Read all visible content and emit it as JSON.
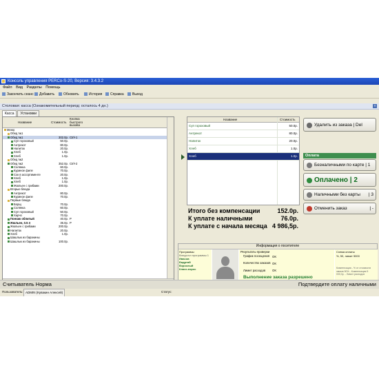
{
  "window": {
    "title": "Консоль управления PERCo-S-20, Версия: 3.4.3.2"
  },
  "menu": [
    "Файл",
    "Вид",
    "Разделы",
    "Помощь"
  ],
  "toolbar": [
    "Закончить сеанс",
    "Добавить",
    "Обновить",
    "История",
    "Справка",
    "Выход"
  ],
  "section_bar": "Столовая: касса (Ознакомительный период: осталось 4 дн.)",
  "tabs": [
    "Касса",
    "Установки"
  ],
  "menu_tree": {
    "columns": {
      "name": "Название",
      "cost": "Стоимость",
      "hotkey": "Кнопка быстрого вызова"
    },
    "rows": [
      {
        "n": "Меню",
        "p": "",
        "k": "",
        "l": 0,
        "t": "f"
      },
      {
        "n": "Обед №1",
        "p": "",
        "k": "",
        "l": 1,
        "t": "f"
      },
      {
        "n": "Обед №1",
        "p": "302.0р.",
        "k": "Ctrl+1",
        "l": 1,
        "t": "d",
        "sel": true
      },
      {
        "n": "Суп гороховый",
        "p": "50.0р.",
        "k": "",
        "l": 2,
        "t": "d"
      },
      {
        "n": "Антрекот",
        "p": "80.0р.",
        "k": "",
        "l": 2,
        "t": "d"
      },
      {
        "n": "Напиток",
        "p": "20.0р.",
        "k": "",
        "l": 2,
        "t": "d"
      },
      {
        "n": "Хлеб",
        "p": "1.0р.",
        "k": "",
        "l": 2,
        "t": "d"
      },
      {
        "n": "Хлеб",
        "p": "1.0р.",
        "k": "",
        "l": 2,
        "t": "d"
      },
      {
        "n": "Обед №2",
        "p": "",
        "k": "",
        "l": 1,
        "t": "f"
      },
      {
        "n": "Обед №2",
        "p": "352.0р.",
        "k": "Ctrl+2",
        "l": 1,
        "t": "d"
      },
      {
        "n": "Солянка",
        "p": "60.0р.",
        "k": "",
        "l": 2,
        "t": "d"
      },
      {
        "n": "Куриное филе",
        "p": "70.0р.",
        "k": "",
        "l": 2,
        "t": "d"
      },
      {
        "n": "Сок в ассортименте",
        "p": "20.0р.",
        "k": "",
        "l": 2,
        "t": "d"
      },
      {
        "n": "Хлеб",
        "p": "1.0р.",
        "k": "",
        "l": 2,
        "t": "d"
      },
      {
        "n": "Хлеб",
        "p": "1.0р.",
        "k": "",
        "l": 2,
        "t": "d"
      },
      {
        "n": "Жюльен с грибами",
        "p": "200.0р.",
        "k": "",
        "l": 2,
        "t": "d"
      },
      {
        "n": "Вторые блюда",
        "p": "",
        "k": "",
        "l": 1,
        "t": "f"
      },
      {
        "n": "Антрекот",
        "p": "80.0р.",
        "k": "",
        "l": 2,
        "t": "d"
      },
      {
        "n": "Куриное филе",
        "p": "70.0р.",
        "k": "",
        "l": 2,
        "t": "d"
      },
      {
        "n": "Первые блюда",
        "p": "",
        "k": "",
        "l": 1,
        "t": "f"
      },
      {
        "n": "Борщ",
        "p": "70.0р.",
        "k": "",
        "l": 2,
        "t": "d"
      },
      {
        "n": "Солянка",
        "p": "60.0р.",
        "k": "",
        "l": 2,
        "t": "d"
      },
      {
        "n": "Суп гороховый",
        "p": "50.0р.",
        "k": "",
        "l": 2,
        "t": "d"
      },
      {
        "n": "Харчо",
        "p": "70.0р.",
        "k": "",
        "l": 2,
        "t": "d"
      },
      {
        "n": "Пончик облитый",
        "p": "40.0р.",
        "k": "P",
        "l": 1,
        "t": "d",
        "b": true
      },
      {
        "n": "Жюльен, 0.5 л",
        "p": "35.0р.",
        "k": "Р",
        "l": 1,
        "t": "d",
        "b": true
      },
      {
        "n": "Жюльен с грибами",
        "p": "200.0р.",
        "k": "",
        "l": 1,
        "t": "d"
      },
      {
        "n": "Напиток",
        "p": "20.0р.",
        "k": "",
        "l": 1,
        "t": "d"
      },
      {
        "n": "Хлеб",
        "p": "1.0р.",
        "k": "",
        "l": 1,
        "t": "d"
      },
      {
        "n": "Шашлык из баранины",
        "p": "",
        "k": "",
        "l": 1,
        "t": "d"
      },
      {
        "n": "Шашлык из баранины",
        "p": "100.0р.",
        "k": "",
        "l": 1,
        "t": "d"
      }
    ]
  },
  "order": {
    "columns": {
      "name": "Название",
      "cost": "Стоимость"
    },
    "rows": [
      {
        "n": "Суп гороховый",
        "p": "50.0р."
      },
      {
        "n": "Антрекот",
        "p": "80.0р."
      },
      {
        "n": "Напиток",
        "p": "20.0р."
      },
      {
        "n": "Хлеб",
        "p": "1.0р."
      },
      {
        "n": "Хлеб",
        "p": "1.0р.",
        "sel": true
      }
    ]
  },
  "totals": [
    {
      "label": "Итого без компенсации",
      "value": "152.0р."
    },
    {
      "label": "К уплате наличными",
      "value": "76.0р."
    },
    {
      "label": "К уплате с начала месяца",
      "value": "4 986,5р."
    }
  ],
  "buttons": {
    "delete": "Удалить из заказа | Del",
    "pay_section": "Оплата",
    "cashless_card": "Безналичными по карте | 1",
    "paid": "Оплачено | 2",
    "cash_no_card": "Наличными без карты",
    "cash_no_card_key": "| 3",
    "cancel": "Отменить заказ",
    "cancel_key": "| -"
  },
  "visitor": {
    "header": "Информация о посетителе",
    "programs_label": "Программы",
    "programs_sub": "Внеурочн программы 1",
    "programs_items": [
      "Ивасов",
      "Бадртай",
      "Взрослый",
      "Класс-взрос"
    ],
    "results_label": "Результаты проверки",
    "results": [
      {
        "k": "График посещения",
        "v": "OK"
      },
      {
        "k": "Количество заказов",
        "v": "OK"
      },
      {
        "k": "Лимит расходов",
        "v": "OK"
      }
    ],
    "allowed": "Выполнение заказа разрешено",
    "payment_label": "Схема оплаты",
    "payment_text": "%, 50, лимит 5000",
    "payment_note": "Компенсация - % от стоимости заказа 50% - Компенсация 5 000,0р. - Лимит расходов",
    "payment_link": "Покупки (2)"
  },
  "status": {
    "left": "Считыватель Норма",
    "right": "Подтвердите оплату наличными"
  },
  "bottom": {
    "user_label": "Пользователь:",
    "user_value": "ADMIN (Кувакин Алексей)",
    "status_label": "Статус:"
  },
  "colors": {
    "selection": "#1a2f7a",
    "paid": "#0a6a1a",
    "titlebar": "#2a5fd6"
  }
}
